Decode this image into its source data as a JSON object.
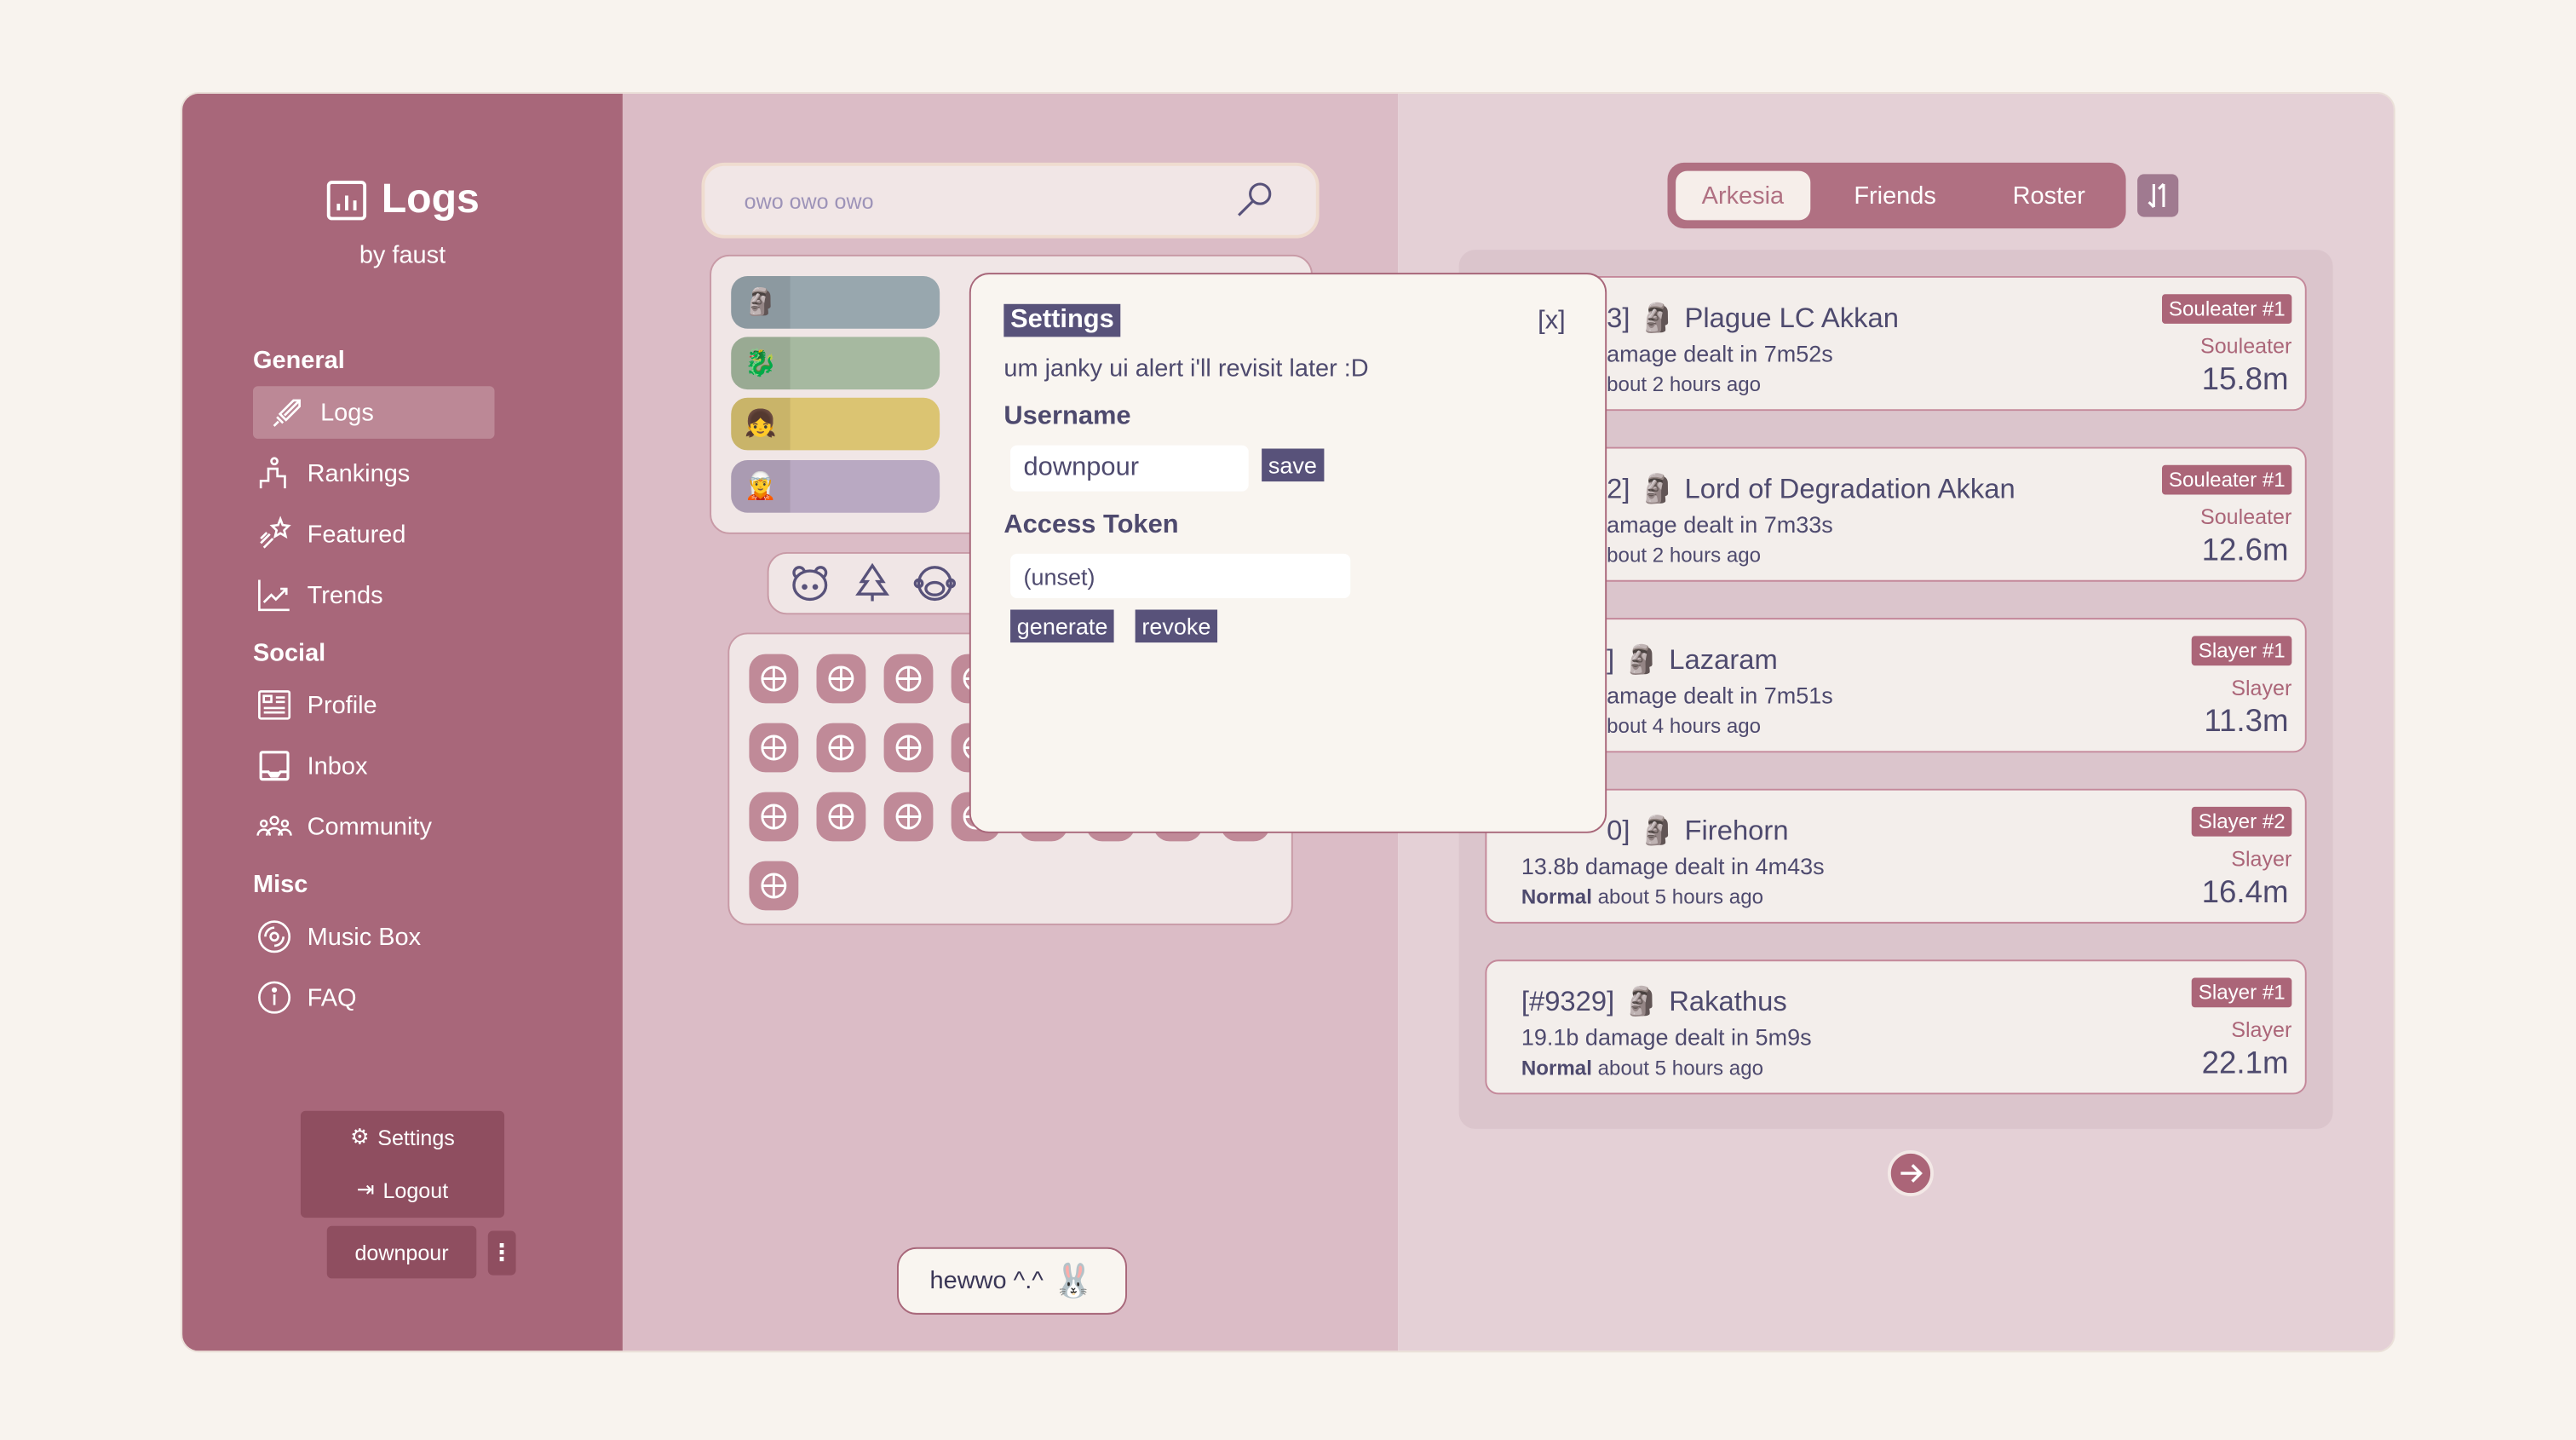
{
  "sidebar": {
    "logo_title": "Logs",
    "logo_subtitle": "by faust",
    "sections": [
      {
        "label": "General",
        "items": [
          {
            "label": "Logs",
            "icon": "sword-icon",
            "active": true
          },
          {
            "label": "Rankings",
            "icon": "podium-icon"
          },
          {
            "label": "Featured",
            "icon": "shooting-star-icon"
          },
          {
            "label": "Trends",
            "icon": "chart-line-icon"
          }
        ]
      },
      {
        "label": "Social",
        "items": [
          {
            "label": "Profile",
            "icon": "id-card-icon"
          },
          {
            "label": "Inbox",
            "icon": "inbox-icon"
          },
          {
            "label": "Community",
            "icon": "users-icon"
          }
        ]
      },
      {
        "label": "Misc",
        "items": [
          {
            "label": "Music Box",
            "icon": "disc-icon"
          },
          {
            "label": "FAQ",
            "icon": "info-icon"
          }
        ]
      }
    ],
    "menu": {
      "settings": "Settings",
      "logout": "Logout"
    },
    "username": "downpour"
  },
  "search": {
    "placeholder": "owo owo owo"
  },
  "class_colors": [
    "#98a7ae",
    "#a6b9a0",
    "#dbc472",
    "#b9a9c2"
  ],
  "hewwo": "hewwo ^.^",
  "modal": {
    "title": "Settings",
    "close": "[x]",
    "message": "um janky ui alert i'll revisit later :D",
    "username_label": "Username",
    "username_value": "downpour",
    "save": "save",
    "token_label": "Access Token",
    "token_value": "(unset)",
    "generate": "generate",
    "revoke": "revoke"
  },
  "tabs": [
    {
      "label": "Arkesia",
      "active": true
    },
    {
      "label": "Friends"
    },
    {
      "label": "Roster"
    }
  ],
  "logs": [
    {
      "id": "3]",
      "boss": "Plague LC Akkan",
      "damage": "amage dealt in 7m52s",
      "diff": "",
      "when": "bout 2 hours ago",
      "badge": "Souleater #1",
      "class": "Souleater",
      "value": "15.8m"
    },
    {
      "id": "2]",
      "boss": "Lord of Degradation Akkan",
      "damage": "amage dealt in 7m33s",
      "diff": "",
      "when": "bout 2 hours ago",
      "badge": "Souleater #1",
      "class": "Souleater",
      "value": "12.6m"
    },
    {
      "id": "]",
      "boss": "Lazaram",
      "damage": "amage dealt in 7m51s",
      "diff": "",
      "when": "bout 4 hours ago",
      "badge": "Slayer #1",
      "class": "Slayer",
      "value": "11.3m"
    },
    {
      "id": "0]",
      "boss": "Firehorn",
      "damage": "13.8b damage dealt in 4m43s",
      "diff": "Normal",
      "when": "about 5 hours ago",
      "badge": "Slayer #2",
      "class": "Slayer",
      "value": "16.4m"
    },
    {
      "id": "[#9329]",
      "boss": "Rakathus",
      "damage": "19.1b damage dealt in 5m9s",
      "diff": "Normal",
      "when": "about 5 hours ago",
      "badge": "Slayer #1",
      "class": "Slayer",
      "value": "22.1m"
    }
  ]
}
